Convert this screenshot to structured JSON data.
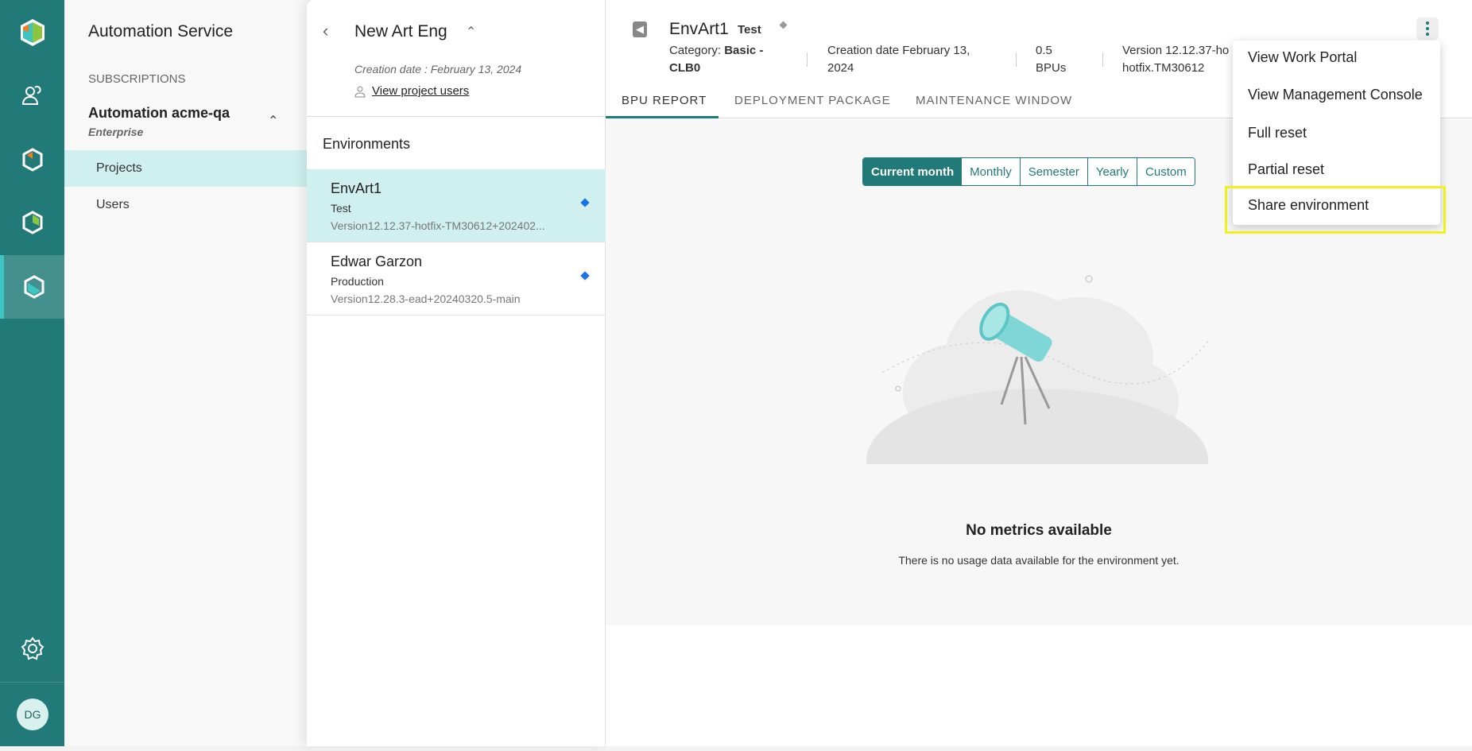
{
  "rail": {
    "icons": [
      "logo-icon",
      "user-management-icon",
      "cube-orange-icon",
      "cube-green-icon",
      "cube-teal-icon",
      "settings-icon"
    ],
    "avatar": "DG",
    "colors": {
      "rail": "#217a78",
      "active": "#43908e"
    }
  },
  "sidebar": {
    "title": "Automation Service",
    "section": "SUBSCRIPTIONS",
    "subscription": {
      "name": "Automation acme-qa",
      "tier": "Enterprise"
    },
    "items": [
      {
        "label": "Projects",
        "selected": true
      },
      {
        "label": "Users",
        "selected": false
      }
    ]
  },
  "project": {
    "name": "New Art Eng",
    "creation_date": "Creation date : February 13, 2024",
    "view_users": "View project users",
    "environments_title": "Environments",
    "environments": [
      {
        "name": "EnvArt1",
        "type": "Test",
        "version": "Version12.12.37-hotfix-TM30612+202402...",
        "selected": true
      },
      {
        "name": "Edwar Garzon",
        "type": "Production",
        "version": "Version12.28.3-ead+20240320.5-main",
        "selected": false
      }
    ]
  },
  "environment": {
    "name": "EnvArt1",
    "type": "Test",
    "category_label": "Category:",
    "category_value": "Basic - CLB0",
    "creation_date": "Creation date February 13, 2024",
    "bpus": "0.5 BPUs",
    "version": "Version 12.12.37-ho hotfix.TM30612",
    "tabs": [
      "BPU REPORT",
      "DEPLOYMENT PACKAGE",
      "MAINTENANCE WINDOW"
    ],
    "active_tab": "BPU REPORT",
    "periods": [
      "Current month",
      "Monthly",
      "Semester",
      "Yearly",
      "Custom"
    ],
    "active_period": "Current month",
    "empty_title": "No metrics available",
    "empty_text": "There is no usage data available for the environment yet."
  },
  "menu": {
    "items": [
      "View Work Portal",
      "View Management Console",
      "Full reset",
      "Partial reset",
      "Share environment"
    ],
    "highlighted": "Share environment",
    "highlight_color": "#f0f020"
  }
}
